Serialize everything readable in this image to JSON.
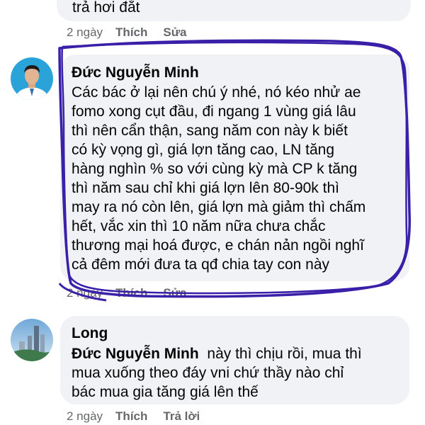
{
  "comments": [
    {
      "text_tail": "trả hơi đắt",
      "time": "2 ngày",
      "like_label": "Thích",
      "edit_label": "Sửa"
    },
    {
      "author": "Đức Nguyễn Minh",
      "text_lines": [
        "Các bác ở lại nên chú ý nhé, nó kéo nhử ae",
        "fomo xong cụt đầu, đi ngang 1 vùng giá lâu",
        "thì nên cẩn thận, sang năm con này k biết",
        "có kỳ vọng gì, giá lợn tăng cao, LN tăng",
        "hàng nghìn % so với cùng kỳ mà CP k tăng",
        "thì năm sau chỉ khi giá lợn lên 80-90k thì",
        "may ra nó còn lên, giá lợn mà giảm thì chấm",
        "hết, vắc xin thì 10 năm nữa chưa chắc",
        "thương mại hoá được, e chán nản ngồi nghĩ",
        "cả đêm mới đưa ta qđ chia tay con này"
      ],
      "time": "2 ngày",
      "like_label": "Thích",
      "edit_label": "Sửa",
      "annotation_color": "#3a1fa8"
    },
    {
      "author": "Long",
      "mention": "Đức Nguyễn Minh",
      "text_line1_rest": "  này thì chịu rồi, mua thì",
      "text_lines": [
        "mua xuống theo đáy vni chứ thầy nào chỉ",
        "bác mua gia tăng giá lên thế"
      ],
      "time": "2 ngày",
      "like_label": "Thích",
      "reply_label": "Trả lời"
    }
  ]
}
